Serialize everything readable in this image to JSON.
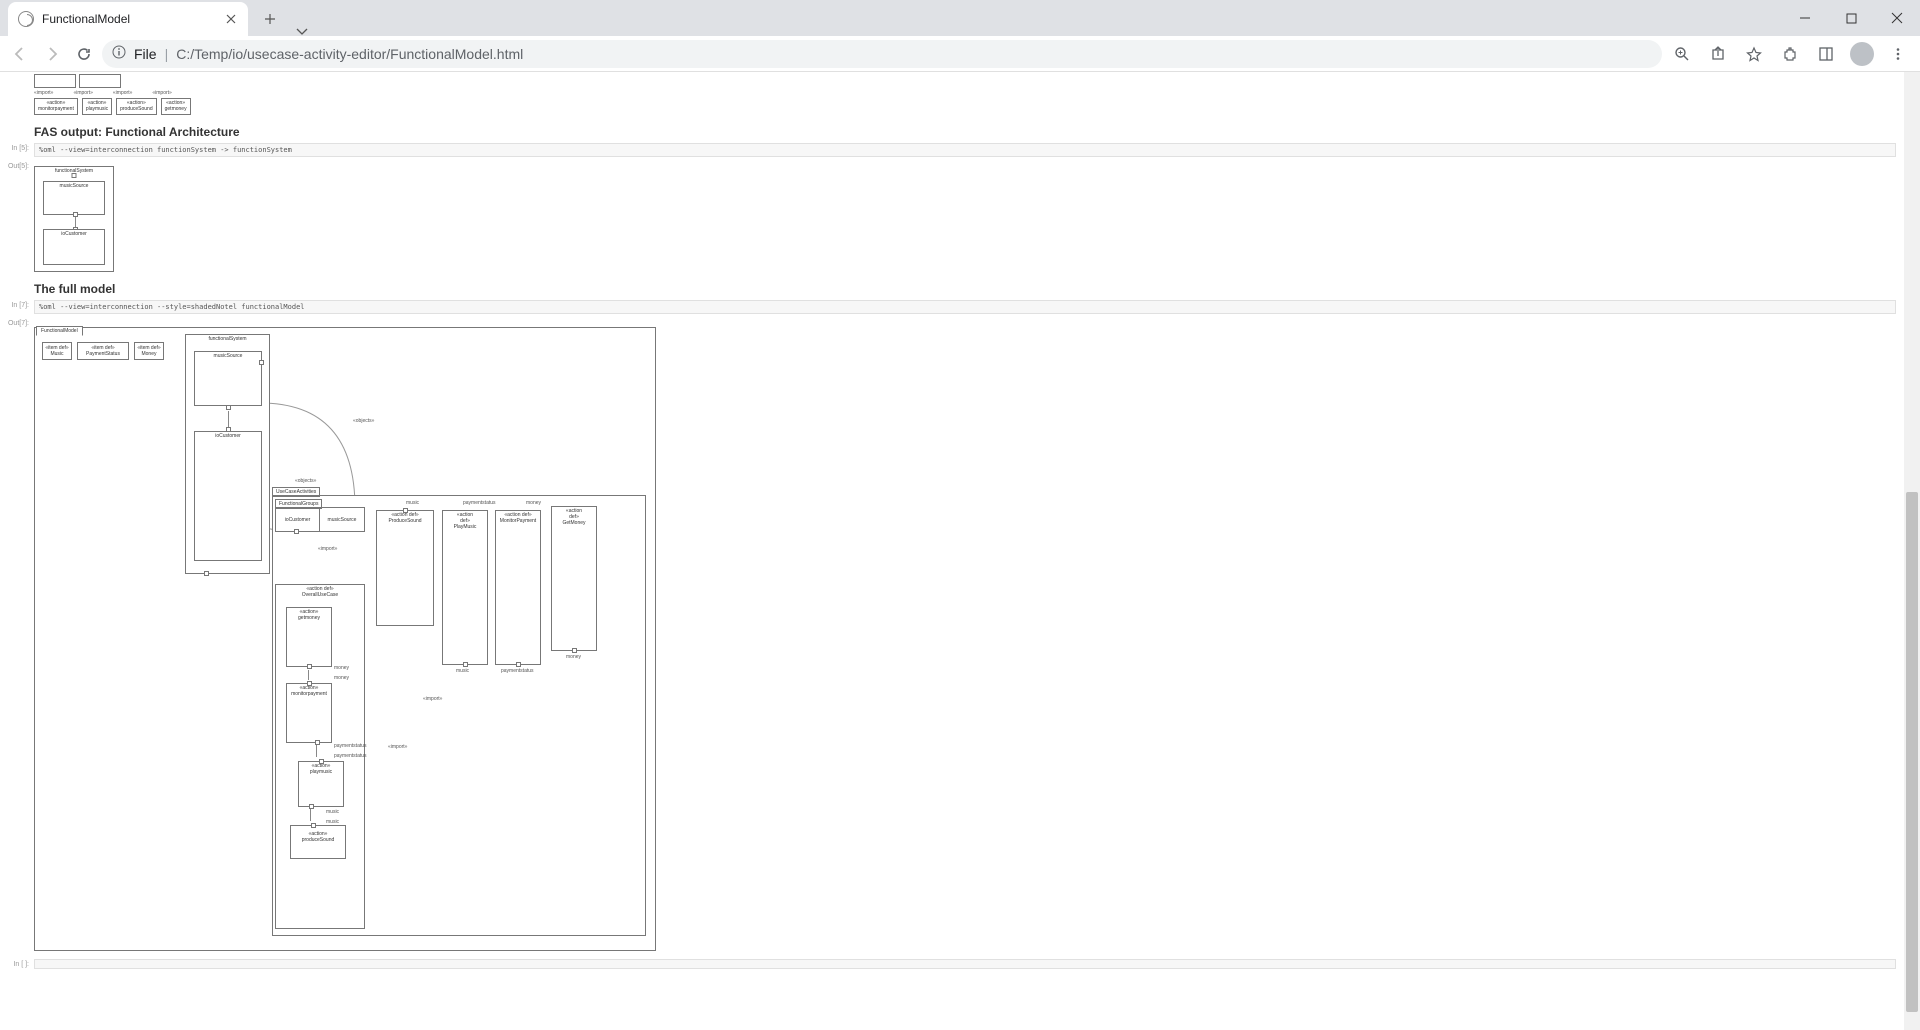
{
  "browser": {
    "tab_title": "FunctionalModel",
    "url_scheme": "File",
    "url_path": "C:/Temp/io/usecase-activity-editor/FunctionalModel.html"
  },
  "topfrag": {
    "ports": [
      "«import»",
      "«import»",
      "«import»",
      "«import»"
    ],
    "actions": [
      {
        "st": "«action»",
        "name": "monitorpayment"
      },
      {
        "st": "«action»",
        "name": "playmusic"
      },
      {
        "st": "«action»",
        "name": "produceSound"
      },
      {
        "st": "«action»",
        "name": "getmoney"
      }
    ]
  },
  "headings": {
    "fas": "FAS output: Functional Architecture",
    "full": "The full model"
  },
  "cells": {
    "fas_prompt": "In [5]:",
    "fas_code": "%oml --view=interconnection functionSystem -> functionSystem",
    "full_prompt": "In [7]:",
    "full_code": "%oml --view=interconnection --style=shadedNotel functionalModel"
  },
  "fas_diag": {
    "title": "functionalSystem",
    "box1": "musicSource",
    "box2": "ioCustomer"
  },
  "full_diag": {
    "tab": "FunctionalModel",
    "itemports": [
      {
        "st": "«item def»",
        "name": "Music"
      },
      {
        "st": "«item def»",
        "name": "PaymentStatus"
      },
      {
        "st": "«item def»",
        "name": "Money"
      }
    ],
    "fs": {
      "title": "functionalSystem",
      "box1": "musicSource",
      "box2": "ioCustomer"
    },
    "uca": {
      "tab": "UseCaseActivities",
      "fg_tab": "FunctionalGroups",
      "fg_col1": "ioCustomer",
      "fg_col2": "musicSource",
      "music_lbl": "music",
      "ps_lbl": "paymentstatus",
      "money_lbl": "money",
      "action1": {
        "st": "«action def»",
        "name": "ProduceSound"
      },
      "action2": {
        "st": "«action def»",
        "name": "PlayMusic"
      },
      "action3": {
        "st": "«action def»",
        "name": "MonitorPayment"
      },
      "action4": {
        "st": "«action def»",
        "name": "GetMoney"
      },
      "port_music": "music",
      "port_ps": "paymentstatus",
      "port_money": "money",
      "oucc": {
        "st": "«action def»",
        "name": "OverallUseCase"
      },
      "seq": [
        {
          "st": "«action»",
          "name": "getmoney"
        },
        {
          "out": "money",
          "in": "money"
        },
        {
          "st": "«action»",
          "name": "monitorpayment"
        },
        {
          "out": "paymentstatus",
          "in": "paymentstatus"
        },
        {
          "st": "«action»",
          "name": "playmusic"
        },
        {
          "out": "music",
          "in": "music"
        },
        {
          "st": "«action»",
          "name": "produceSound"
        }
      ],
      "import_lbl": "«import»",
      "object_lbl": "«objects»"
    }
  }
}
